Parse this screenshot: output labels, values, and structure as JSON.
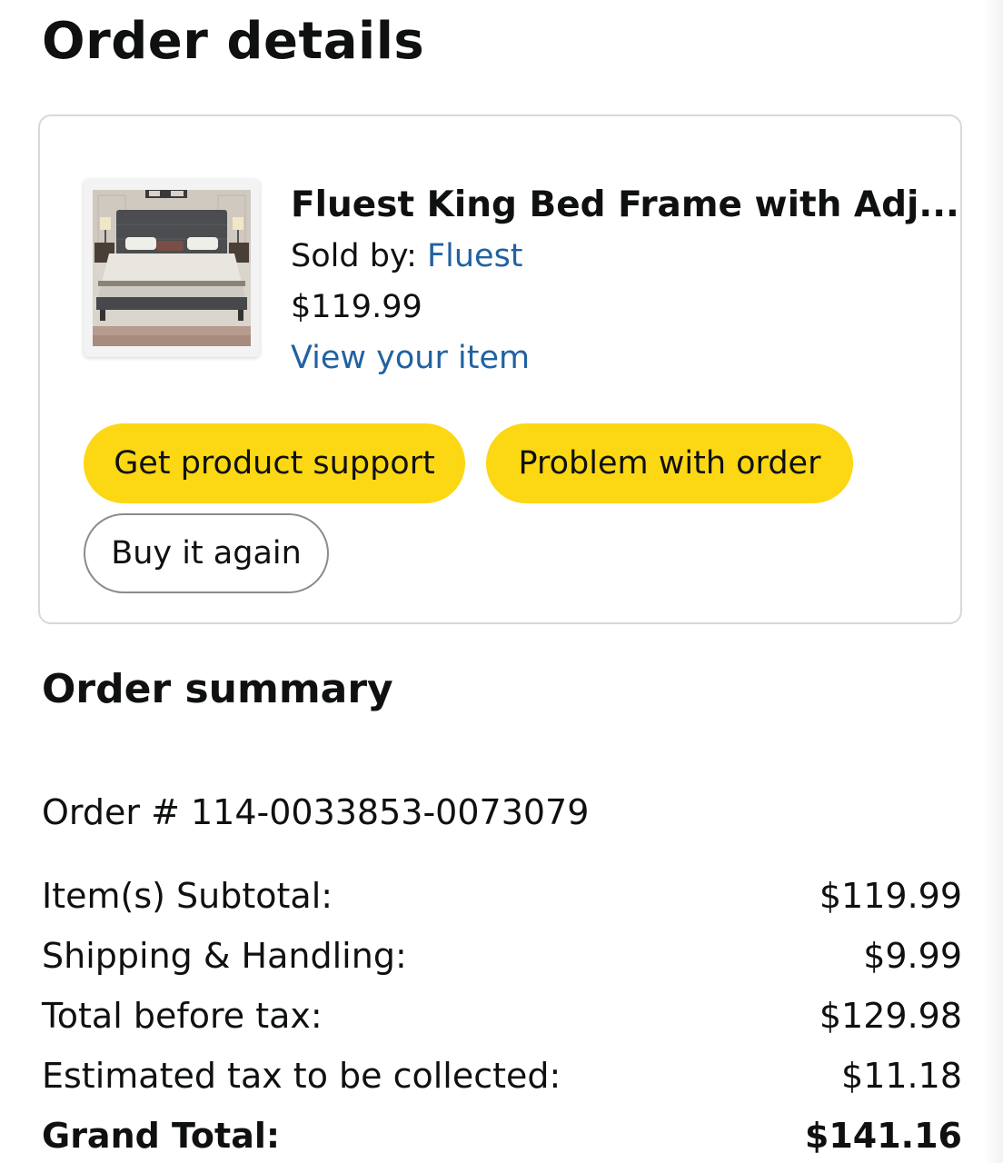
{
  "page": {
    "title": "Order details"
  },
  "item": {
    "title": "Fluest King Bed Frame with Adj...",
    "sold_by_label": "Sold by: ",
    "seller": "Fluest",
    "price": "$119.99",
    "view_link": "View your item",
    "image_icon": "bed-product-image"
  },
  "actions": {
    "product_support": "Get product support",
    "problem": "Problem with order",
    "buy_again": "Buy it again"
  },
  "summary": {
    "title": "Order summary",
    "order_number": "Order # 114-0033853-0073079",
    "rows": [
      {
        "label": "Item(s) Subtotal:",
        "value": "$119.99"
      },
      {
        "label": "Shipping & Handling:",
        "value": "$9.99"
      },
      {
        "label": "Total before tax:",
        "value": "$129.98"
      },
      {
        "label": "Estimated tax to be collected:",
        "value": "$11.18"
      }
    ],
    "grand_total": {
      "label": "Grand Total:",
      "value": "$141.16"
    }
  },
  "colors": {
    "button_yellow": "#fcd713",
    "link_blue": "#2162a1",
    "card_border": "#d5d9d9",
    "text": "#0f1111"
  }
}
